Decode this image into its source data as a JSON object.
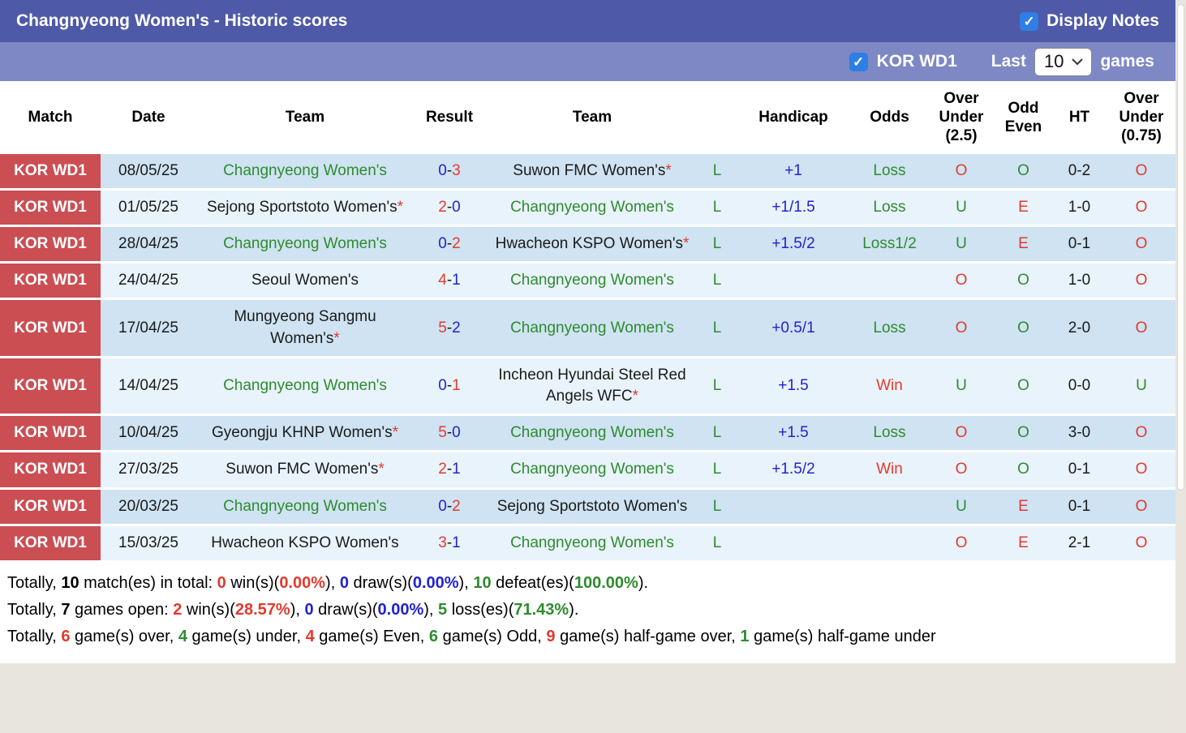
{
  "header": {
    "title": "Changnyeong Women's - Historic scores",
    "display_notes_label": "Display Notes",
    "display_notes_checked": true
  },
  "controls": {
    "league_label": "KOR WD1",
    "league_checked": true,
    "last_label": "Last",
    "selected_games": "10",
    "games_label": "games"
  },
  "colors": {
    "bar_dark": "#4e5aa8",
    "bar_light": "#7d88c5",
    "checkbox_blue": "#2e7ee6",
    "badge_red": "#cb4e53",
    "row_dark": "#cfe3f2",
    "row_light": "#e9f3fb",
    "text_green": "#2e8b2e",
    "text_red": "#e23a2d",
    "text_blue": "#2222cf"
  },
  "table": {
    "headers": {
      "match": "Match",
      "date": "Date",
      "team1": "Team",
      "result": "Result",
      "team2": "Team",
      "handicap": "Handicap",
      "odds": "Odds",
      "ou25": "Over\nUnder\n(2.5)",
      "oddeven": "Odd\nEven",
      "ht": "HT",
      "ou075": "Over\nUnder\n(0.75)"
    },
    "rows": [
      {
        "match": "KOR WD1",
        "date": "08/05/25",
        "team1": {
          "name": "Changnyeong Women's",
          "highlight": true,
          "star": false
        },
        "score": {
          "left": "0",
          "leftColor": "blue",
          "right": "3",
          "rightColor": "red"
        },
        "team2": {
          "name": "Suwon FMC Women's",
          "highlight": false,
          "star": true
        },
        "league_link": "L",
        "handicap": "+1",
        "odds": {
          "text": "Loss",
          "color": "green"
        },
        "ou25": {
          "text": "O",
          "color": "red"
        },
        "oddeven": {
          "text": "O",
          "color": "green"
        },
        "ht": "0-2",
        "ou075": {
          "text": "O",
          "color": "red"
        }
      },
      {
        "match": "KOR WD1",
        "date": "01/05/25",
        "team1": {
          "name": "Sejong Sportstoto Women's",
          "highlight": false,
          "star": true
        },
        "score": {
          "left": "2",
          "leftColor": "red",
          "right": "0",
          "rightColor": "blue"
        },
        "team2": {
          "name": "Changnyeong Women's",
          "highlight": true,
          "star": false
        },
        "league_link": "L",
        "handicap": "+1/1.5",
        "odds": {
          "text": "Loss",
          "color": "green"
        },
        "ou25": {
          "text": "U",
          "color": "green"
        },
        "oddeven": {
          "text": "E",
          "color": "red"
        },
        "ht": "1-0",
        "ou075": {
          "text": "O",
          "color": "red"
        }
      },
      {
        "match": "KOR WD1",
        "date": "28/04/25",
        "team1": {
          "name": "Changnyeong Women's",
          "highlight": true,
          "star": false
        },
        "score": {
          "left": "0",
          "leftColor": "blue",
          "right": "2",
          "rightColor": "red"
        },
        "team2": {
          "name": "Hwacheon KSPO Women's",
          "highlight": false,
          "star": true
        },
        "league_link": "L",
        "handicap": "+1.5/2",
        "odds": {
          "text": "Loss1/2",
          "color": "green"
        },
        "ou25": {
          "text": "U",
          "color": "green"
        },
        "oddeven": {
          "text": "E",
          "color": "red"
        },
        "ht": "0-1",
        "ou075": {
          "text": "O",
          "color": "red"
        }
      },
      {
        "match": "KOR WD1",
        "date": "24/04/25",
        "team1": {
          "name": "Seoul Women's",
          "highlight": false,
          "star": false
        },
        "score": {
          "left": "4",
          "leftColor": "red",
          "right": "1",
          "rightColor": "blue"
        },
        "team2": {
          "name": "Changnyeong Women's",
          "highlight": true,
          "star": false
        },
        "league_link": "L",
        "handicap": "",
        "odds": {
          "text": "",
          "color": "green"
        },
        "ou25": {
          "text": "O",
          "color": "red"
        },
        "oddeven": {
          "text": "O",
          "color": "green"
        },
        "ht": "1-0",
        "ou075": {
          "text": "O",
          "color": "red"
        }
      },
      {
        "match": "KOR WD1",
        "date": "17/04/25",
        "team1": {
          "name": "Mungyeong Sangmu Women's",
          "highlight": false,
          "star": true
        },
        "score": {
          "left": "5",
          "leftColor": "red",
          "right": "2",
          "rightColor": "blue"
        },
        "team2": {
          "name": "Changnyeong Women's",
          "highlight": true,
          "star": false
        },
        "league_link": "L",
        "handicap": "+0.5/1",
        "odds": {
          "text": "Loss",
          "color": "green"
        },
        "ou25": {
          "text": "O",
          "color": "red"
        },
        "oddeven": {
          "text": "O",
          "color": "green"
        },
        "ht": "2-0",
        "ou075": {
          "text": "O",
          "color": "red"
        }
      },
      {
        "match": "KOR WD1",
        "date": "14/04/25",
        "team1": {
          "name": "Changnyeong Women's",
          "highlight": true,
          "star": false
        },
        "score": {
          "left": "0",
          "leftColor": "blue",
          "right": "1",
          "rightColor": "red"
        },
        "team2": {
          "name": "Incheon Hyundai Steel Red Angels WFC",
          "highlight": false,
          "star": true
        },
        "league_link": "L",
        "handicap": "+1.5",
        "odds": {
          "text": "Win",
          "color": "red"
        },
        "ou25": {
          "text": "U",
          "color": "green"
        },
        "oddeven": {
          "text": "O",
          "color": "green"
        },
        "ht": "0-0",
        "ou075": {
          "text": "U",
          "color": "green"
        }
      },
      {
        "match": "KOR WD1",
        "date": "10/04/25",
        "team1": {
          "name": "Gyeongju KHNP Women's",
          "highlight": false,
          "star": true
        },
        "score": {
          "left": "5",
          "leftColor": "red",
          "right": "0",
          "rightColor": "blue"
        },
        "team2": {
          "name": "Changnyeong Women's",
          "highlight": true,
          "star": false
        },
        "league_link": "L",
        "handicap": "+1.5",
        "odds": {
          "text": "Loss",
          "color": "green"
        },
        "ou25": {
          "text": "O",
          "color": "red"
        },
        "oddeven": {
          "text": "O",
          "color": "green"
        },
        "ht": "3-0",
        "ou075": {
          "text": "O",
          "color": "red"
        }
      },
      {
        "match": "KOR WD1",
        "date": "27/03/25",
        "team1": {
          "name": "Suwon FMC Women's",
          "highlight": false,
          "star": true
        },
        "score": {
          "left": "2",
          "leftColor": "red",
          "right": "1",
          "rightColor": "blue"
        },
        "team2": {
          "name": "Changnyeong Women's",
          "highlight": true,
          "star": false
        },
        "league_link": "L",
        "handicap": "+1.5/2",
        "odds": {
          "text": "Win",
          "color": "red"
        },
        "ou25": {
          "text": "O",
          "color": "red"
        },
        "oddeven": {
          "text": "O",
          "color": "green"
        },
        "ht": "0-1",
        "ou075": {
          "text": "O",
          "color": "red"
        }
      },
      {
        "match": "KOR WD1",
        "date": "20/03/25",
        "team1": {
          "name": "Changnyeong Women's",
          "highlight": true,
          "star": false
        },
        "score": {
          "left": "0",
          "leftColor": "blue",
          "right": "2",
          "rightColor": "red"
        },
        "team2": {
          "name": "Sejong Sportstoto Women's",
          "highlight": false,
          "star": false
        },
        "league_link": "L",
        "handicap": "",
        "odds": {
          "text": "",
          "color": "green"
        },
        "ou25": {
          "text": "U",
          "color": "green"
        },
        "oddeven": {
          "text": "E",
          "color": "red"
        },
        "ht": "0-1",
        "ou075": {
          "text": "O",
          "color": "red"
        }
      },
      {
        "match": "KOR WD1",
        "date": "15/03/25",
        "team1": {
          "name": "Hwacheon KSPO Women's",
          "highlight": false,
          "star": false
        },
        "score": {
          "left": "3",
          "leftColor": "red",
          "right": "1",
          "rightColor": "blue"
        },
        "team2": {
          "name": "Changnyeong Women's",
          "highlight": true,
          "star": false
        },
        "league_link": "L",
        "handicap": "",
        "odds": {
          "text": "",
          "color": "green"
        },
        "ou25": {
          "text": "O",
          "color": "red"
        },
        "oddeven": {
          "text": "E",
          "color": "red"
        },
        "ht": "2-1",
        "ou075": {
          "text": "O",
          "color": "red"
        }
      }
    ]
  },
  "summary": {
    "lines": [
      [
        {
          "t": "Totally, ",
          "c": "plain"
        },
        {
          "t": "10",
          "c": "bold"
        },
        {
          "t": " match(es) in total: ",
          "c": "plain"
        },
        {
          "t": "0",
          "c": "red"
        },
        {
          "t": " win(s)(",
          "c": "plain"
        },
        {
          "t": "0.00%",
          "c": "red"
        },
        {
          "t": "), ",
          "c": "plain"
        },
        {
          "t": "0",
          "c": "blue"
        },
        {
          "t": " draw(s)(",
          "c": "plain"
        },
        {
          "t": "0.00%",
          "c": "blue"
        },
        {
          "t": "), ",
          "c": "plain"
        },
        {
          "t": "10",
          "c": "green"
        },
        {
          "t": " defeat(es)(",
          "c": "plain"
        },
        {
          "t": "100.00%",
          "c": "green"
        },
        {
          "t": ").",
          "c": "plain"
        }
      ],
      [
        {
          "t": "Totally, ",
          "c": "plain"
        },
        {
          "t": "7",
          "c": "bold"
        },
        {
          "t": " games open: ",
          "c": "plain"
        },
        {
          "t": "2",
          "c": "red"
        },
        {
          "t": " win(s)(",
          "c": "plain"
        },
        {
          "t": "28.57%",
          "c": "red"
        },
        {
          "t": "), ",
          "c": "plain"
        },
        {
          "t": "0",
          "c": "blue"
        },
        {
          "t": " draw(s)(",
          "c": "plain"
        },
        {
          "t": "0.00%",
          "c": "blue"
        },
        {
          "t": "), ",
          "c": "plain"
        },
        {
          "t": "5",
          "c": "green"
        },
        {
          "t": " loss(es)(",
          "c": "plain"
        },
        {
          "t": "71.43%",
          "c": "green"
        },
        {
          "t": ").",
          "c": "plain"
        }
      ],
      [
        {
          "t": "Totally, ",
          "c": "plain"
        },
        {
          "t": "6",
          "c": "red"
        },
        {
          "t": " game(s) over, ",
          "c": "plain"
        },
        {
          "t": "4",
          "c": "green"
        },
        {
          "t": " game(s) under, ",
          "c": "plain"
        },
        {
          "t": "4",
          "c": "red"
        },
        {
          "t": " game(s) Even, ",
          "c": "plain"
        },
        {
          "t": "6",
          "c": "green"
        },
        {
          "t": " game(s) Odd, ",
          "c": "plain"
        },
        {
          "t": "9",
          "c": "red"
        },
        {
          "t": " game(s) half-game over, ",
          "c": "plain"
        },
        {
          "t": "1",
          "c": "green"
        },
        {
          "t": " game(s) half-game under",
          "c": "plain"
        }
      ]
    ]
  }
}
